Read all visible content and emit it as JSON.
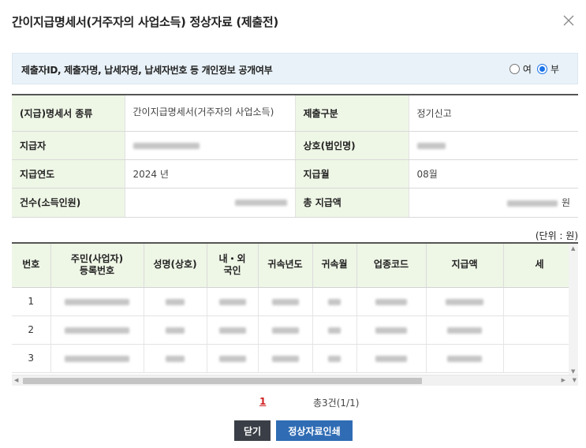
{
  "dialog": {
    "title": "간이지급명세서(거주자의 사업소득) 정상자료 (제출전)",
    "close_icon": "close-icon"
  },
  "privacy": {
    "label": "제출자ID, 제출자명, 납세자명, 납세자번호 등 개인정보 공개여부",
    "options": [
      {
        "label": "여",
        "checked": false
      },
      {
        "label": "부",
        "checked": true
      }
    ]
  },
  "info": {
    "rows": [
      [
        {
          "label": "(지급)명세서 종류",
          "value": "간이지급명세서(거주자의 사업소득)"
        },
        {
          "label": "제출구분",
          "value": "정기신고"
        }
      ],
      [
        {
          "label": "지급자",
          "value": ""
        },
        {
          "label": "상호(법인명)",
          "value": ""
        }
      ],
      [
        {
          "label": "지급연도",
          "value": "2024 년"
        },
        {
          "label": "지급월",
          "value": "08월"
        }
      ],
      [
        {
          "label": "건수(소득인원)",
          "value": ""
        },
        {
          "label": "총 지급액",
          "value": "원"
        }
      ]
    ]
  },
  "unit_label": "(단위 : 원)",
  "grid": {
    "headers": [
      "번호",
      "주민(사업자)\n등록번호",
      "성명(상호)",
      "내・외\n국인",
      "귀속년도",
      "귀속월",
      "업종코드",
      "지급액",
      "세"
    ],
    "rows": [
      {
        "no": "1"
      },
      {
        "no": "2"
      },
      {
        "no": "3"
      }
    ]
  },
  "pager": {
    "current_page": "1",
    "total": "총3건(1/1)"
  },
  "buttons": {
    "close": "닫기",
    "print": "정상자료인쇄"
  },
  "colors": {
    "header_bg": "#eef6e6",
    "privacy_bg": "#e9f2f8",
    "btn_dark": "#3a3f47",
    "btn_blue": "#2f6cb4",
    "page_active": "#d02020"
  }
}
